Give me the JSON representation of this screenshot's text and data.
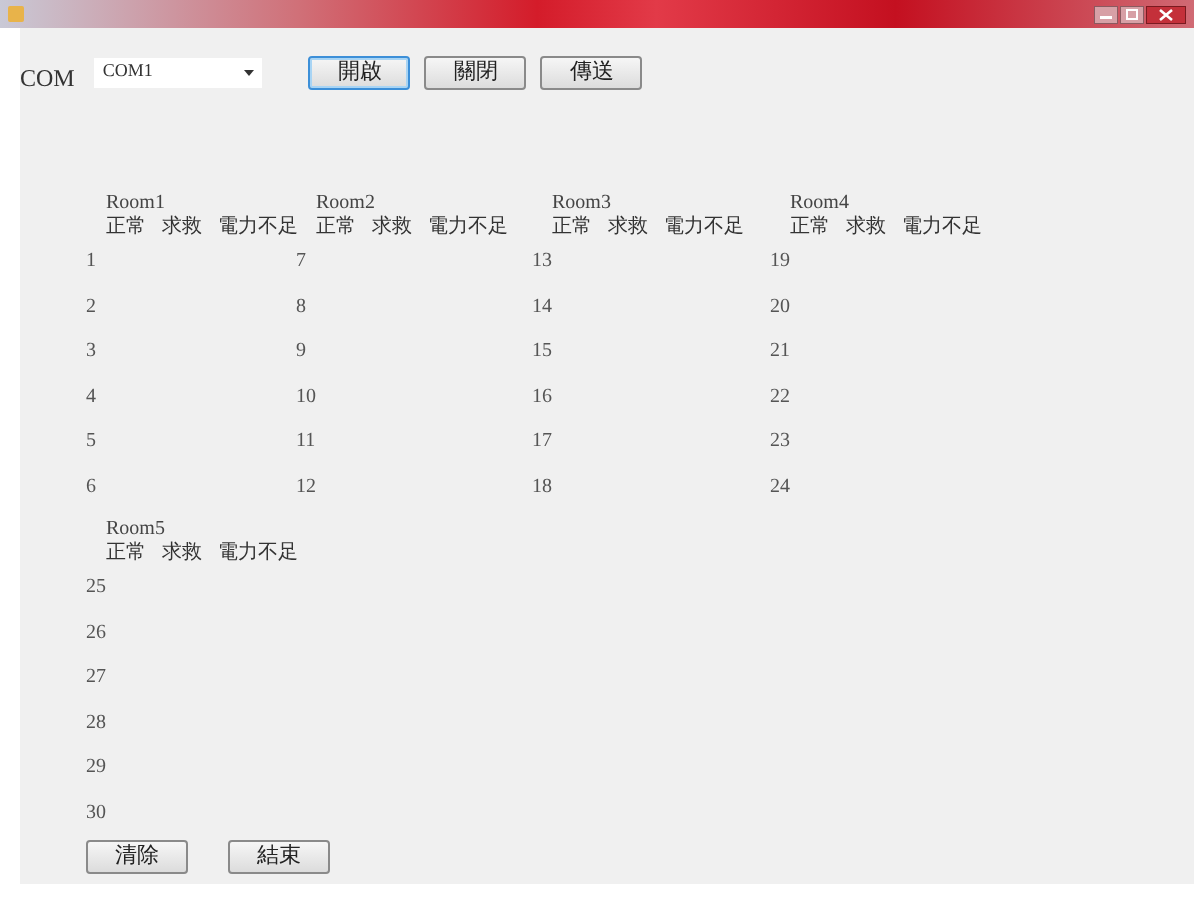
{
  "com_label": "COM",
  "port_select": {
    "value": "COM1"
  },
  "top_buttons": [
    {
      "label": "開啟",
      "focused": true
    },
    {
      "label": "關閉",
      "focused": false
    },
    {
      "label": "傳送",
      "focused": false
    }
  ],
  "rooms": [
    {
      "name": "Room1",
      "headers": [
        "正常",
        "求救",
        "電力不足"
      ],
      "numbers": [
        "1",
        "2",
        "3",
        "4",
        "5",
        "6"
      ]
    },
    {
      "name": "Room2",
      "headers": [
        "正常",
        "求救",
        "電力不足"
      ],
      "numbers": [
        "7",
        "8",
        "9",
        "10",
        "11",
        "12"
      ]
    },
    {
      "name": "Room3",
      "headers": [
        "正常",
        "求救",
        "電力不足"
      ],
      "numbers": [
        "13",
        "14",
        "15",
        "16",
        "17",
        "18"
      ]
    },
    {
      "name": "Room4",
      "headers": [
        "正常",
        "求救",
        "電力不足"
      ],
      "numbers": [
        "19",
        "20",
        "21",
        "22",
        "23",
        "24"
      ]
    },
    {
      "name": "Room5",
      "headers": [
        "正常",
        "求救",
        "電力不足"
      ],
      "numbers": [
        "25",
        "26",
        "27",
        "28",
        "29",
        "30"
      ]
    }
  ],
  "bottom_buttons": [
    {
      "label": "清除",
      "focused": false
    },
    {
      "label": "結束",
      "focused": false
    }
  ]
}
